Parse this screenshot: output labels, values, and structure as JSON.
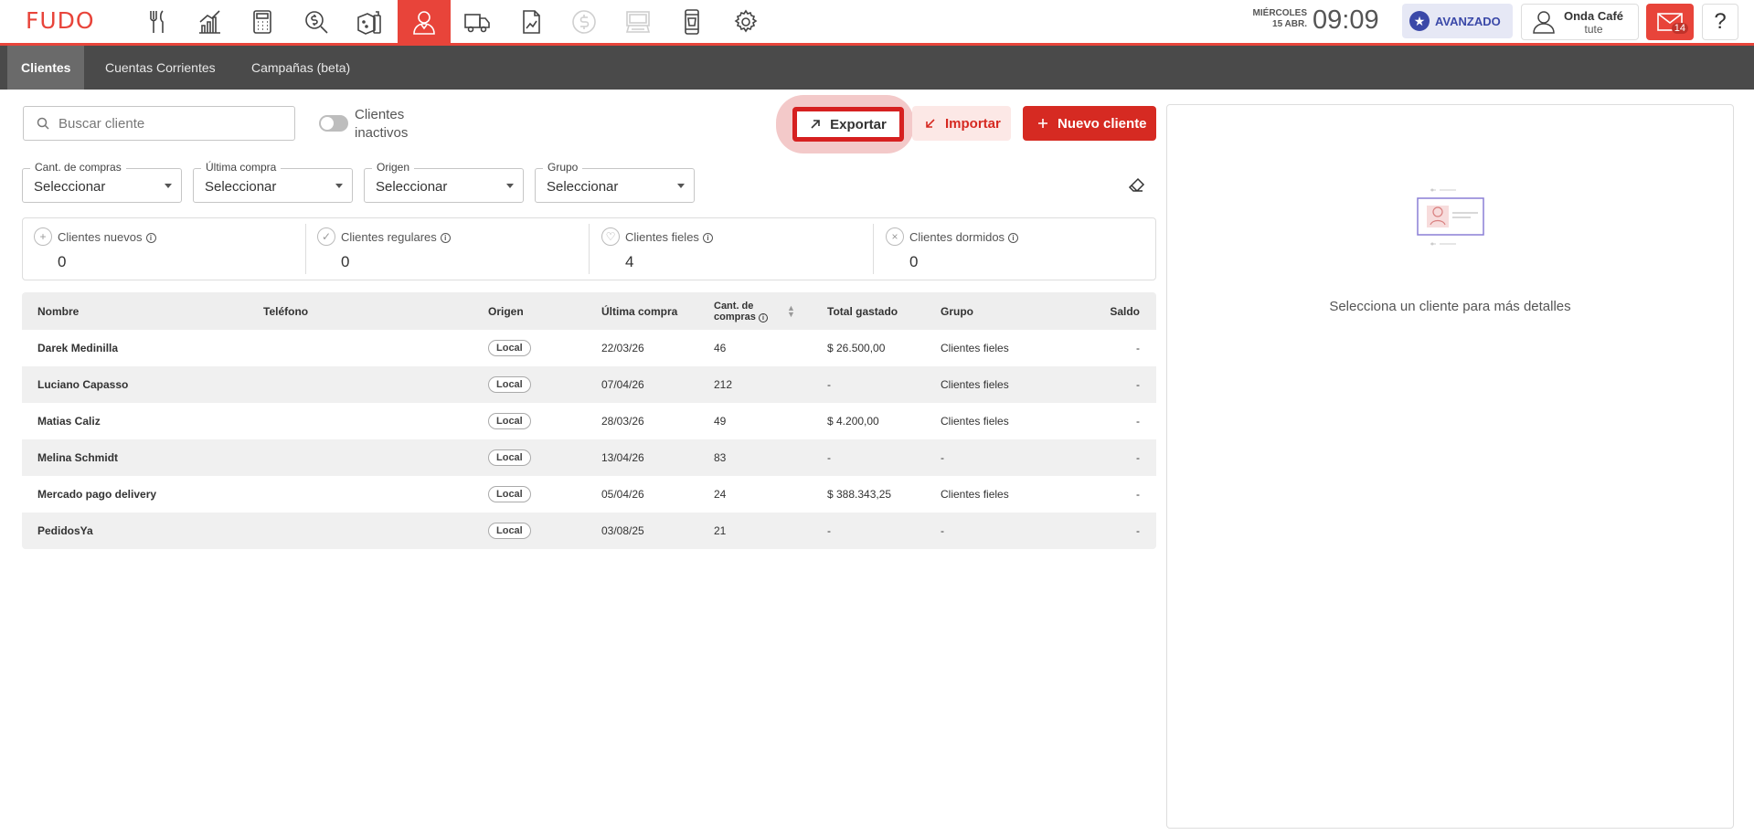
{
  "brand": {
    "logo": "FUDO",
    "accent": "#e8443a"
  },
  "topnav": {
    "icons": [
      "cutlery-icon",
      "bar-chart-icon",
      "calculator-icon",
      "search-money-icon",
      "ingredients-icon",
      "customer-icon",
      "delivery-truck-icon",
      "report-icon",
      "dollar-icon",
      "cash-register-icon",
      "mobile-order-icon",
      "settings-icon"
    ],
    "active": "customer-icon"
  },
  "header": {
    "day": "MIÉRCOLES",
    "date": "15 ABR.",
    "time": "09:09",
    "plan": "AVANZADO",
    "user_name": "Onda Café",
    "user_sub": "tute",
    "mail_count": "14",
    "help": "?"
  },
  "subnav": {
    "tabs": [
      {
        "label": "Clientes",
        "active": true
      },
      {
        "label": "Cuentas Corrientes",
        "active": false
      },
      {
        "label": "Campañas (beta)",
        "active": false
      }
    ]
  },
  "toolbar": {
    "search_placeholder": "Buscar cliente",
    "inactive_label": "Clientes inactivos",
    "export_label": "Exportar",
    "import_label": "Importar",
    "new_label": "Nuevo cliente"
  },
  "filters": [
    {
      "label": "Cant. de compras",
      "value": "Seleccionar"
    },
    {
      "label": "Última compra",
      "value": "Seleccionar"
    },
    {
      "label": "Origen",
      "value": "Seleccionar"
    },
    {
      "label": "Grupo",
      "value": "Seleccionar"
    }
  ],
  "stats": [
    {
      "title": "Clientes nuevos",
      "value": "0",
      "icon": "+"
    },
    {
      "title": "Clientes regulares",
      "value": "0",
      "icon": "✓"
    },
    {
      "title": "Clientes fieles",
      "value": "4",
      "icon": "♡"
    },
    {
      "title": "Clientes dormidos",
      "value": "0",
      "icon": "×"
    }
  ],
  "table": {
    "headers": {
      "nombre": "Nombre",
      "telefono": "Teléfono",
      "origen": "Origen",
      "ultima": "Última compra",
      "cant_1": "Cant. de",
      "cant_2": "compras",
      "total": "Total gastado",
      "grupo": "Grupo",
      "saldo": "Saldo"
    },
    "rows": [
      {
        "nombre": "Darek Medinilla",
        "telefono": "",
        "origen": "Local",
        "ultima": "22/03/26",
        "cant": "46",
        "total": "$ 26.500,00",
        "grupo": "Clientes fieles",
        "saldo": "-"
      },
      {
        "nombre": "Luciano Capasso",
        "telefono": "",
        "origen": "Local",
        "ultima": "07/04/26",
        "cant": "212",
        "total": "-",
        "grupo": "Clientes fieles",
        "saldo": "-"
      },
      {
        "nombre": "Matias Caliz",
        "telefono": "",
        "origen": "Local",
        "ultima": "28/03/26",
        "cant": "49",
        "total": "$ 4.200,00",
        "grupo": "Clientes fieles",
        "saldo": "-"
      },
      {
        "nombre": "Melina Schmidt",
        "telefono": "",
        "origen": "Local",
        "ultima": "13/04/26",
        "cant": "83",
        "total": "-",
        "grupo": "-",
        "saldo": "-"
      },
      {
        "nombre": "Mercado pago delivery",
        "telefono": "",
        "origen": "Local",
        "ultima": "05/04/26",
        "cant": "24",
        "total": "$ 388.343,25",
        "grupo": "Clientes fieles",
        "saldo": "-"
      },
      {
        "nombre": "PedidosYa",
        "telefono": "",
        "origen": "Local",
        "ultima": "03/08/25",
        "cant": "21",
        "total": "-",
        "grupo": "-",
        "saldo": "-"
      }
    ]
  },
  "detail_panel": {
    "message": "Selecciona un cliente para más detalles"
  }
}
